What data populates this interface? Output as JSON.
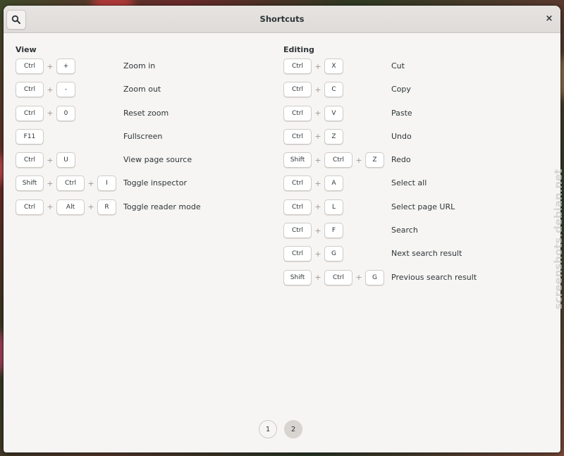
{
  "window": {
    "title": "Shortcuts"
  },
  "sections": {
    "view": {
      "title": "View",
      "shortcuts": [
        {
          "keys": [
            "Ctrl",
            "+"
          ],
          "description": "Zoom in"
        },
        {
          "keys": [
            "Ctrl",
            "-"
          ],
          "description": "Zoom out"
        },
        {
          "keys": [
            "Ctrl",
            "0"
          ],
          "description": "Reset zoom"
        },
        {
          "keys": [
            "F11"
          ],
          "description": "Fullscreen"
        },
        {
          "keys": [
            "Ctrl",
            "U"
          ],
          "description": "View page source"
        },
        {
          "keys": [
            "Shift",
            "Ctrl",
            "I"
          ],
          "description": "Toggle inspector"
        },
        {
          "keys": [
            "Ctrl",
            "Alt",
            "R"
          ],
          "description": "Toggle reader mode"
        }
      ]
    },
    "editing": {
      "title": "Editing",
      "shortcuts": [
        {
          "keys": [
            "Ctrl",
            "X"
          ],
          "description": "Cut"
        },
        {
          "keys": [
            "Ctrl",
            "C"
          ],
          "description": "Copy"
        },
        {
          "keys": [
            "Ctrl",
            "V"
          ],
          "description": "Paste"
        },
        {
          "keys": [
            "Ctrl",
            "Z"
          ],
          "description": "Undo"
        },
        {
          "keys": [
            "Shift",
            "Ctrl",
            "Z"
          ],
          "description": "Redo"
        },
        {
          "keys": [
            "Ctrl",
            "A"
          ],
          "description": "Select all"
        },
        {
          "keys": [
            "Ctrl",
            "L"
          ],
          "description": "Select page URL"
        },
        {
          "keys": [
            "Ctrl",
            "F"
          ],
          "description": "Search"
        },
        {
          "keys": [
            "Ctrl",
            "G"
          ],
          "description": "Next search result"
        },
        {
          "keys": [
            "Shift",
            "Ctrl",
            "G"
          ],
          "description": "Previous search result"
        }
      ]
    }
  },
  "pager": {
    "pages": [
      "1",
      "2"
    ],
    "active": "2"
  },
  "plus_symbol": "+",
  "watermark": "screenshots.debian.net",
  "icons": {
    "search": "search-icon",
    "close": "close-icon"
  }
}
